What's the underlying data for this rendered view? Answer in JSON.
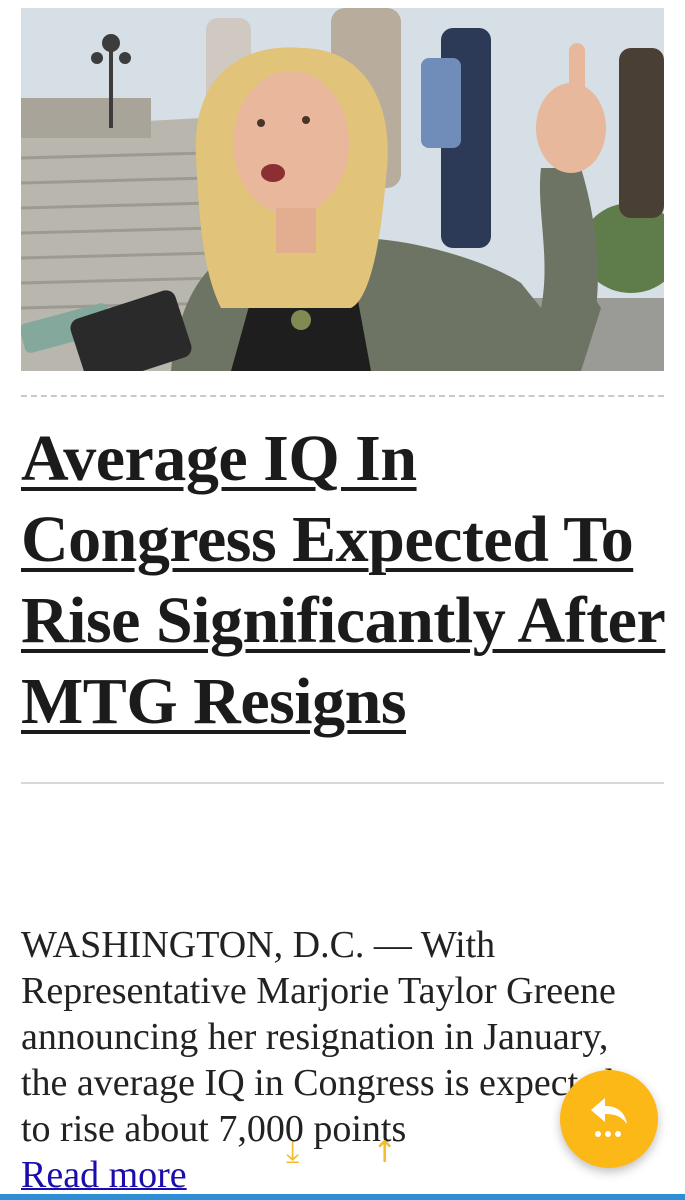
{
  "article": {
    "image_alt": "Marjorie Taylor Greene speaking outside the Capitol",
    "headline": "Average IQ In Congress Expected To Rise Significantly After MTG Resigns",
    "excerpt": "WASHINGTON, D.C. — With Representative Marjorie Taylor Greene announcing her resignation in January, the average IQ in Congress is expected to rise about 7,000 points",
    "read_more": "Read more"
  },
  "controls": {
    "download_icon": "download-icon",
    "scroll_top_icon": "arrow-up-icon",
    "fab_icon": "reply-more-icon"
  },
  "colors": {
    "link": "#1a0dab",
    "accent": "#fbb817",
    "bottom_bar": "#2c8fd6"
  }
}
